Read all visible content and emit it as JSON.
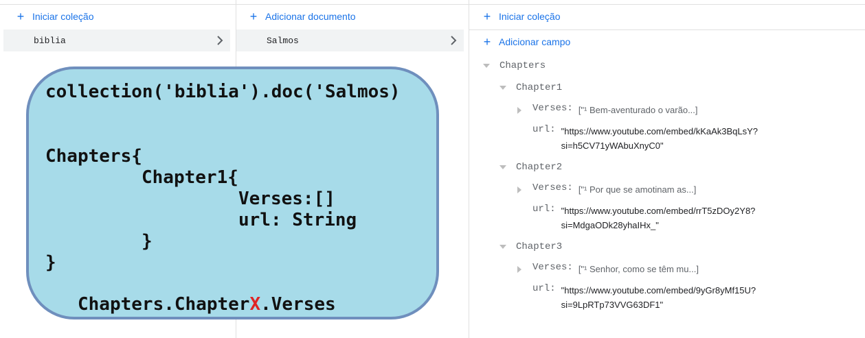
{
  "panel1": {
    "add_label": "Iniciar coleção",
    "items": [
      {
        "label": "biblia"
      }
    ]
  },
  "panel2": {
    "add_label": "Adicionar documento",
    "items": [
      {
        "label": "Salmos"
      }
    ]
  },
  "panel3": {
    "add_collection_label": "Iniciar coleção",
    "add_field_label": "Adicionar campo",
    "root_field": "Chapters",
    "chapters": [
      {
        "name": "Chapter1",
        "verses_key": "Verses:",
        "verses_value": "[\"¹ Bem-aventurado o varão...]",
        "url_key": "url:",
        "url_line1": "\"https://www.youtube.com/embed/kKaAk3BqLsY?",
        "url_line2": "si=h5CV71yWAbuXnyC0\""
      },
      {
        "name": "Chapter2",
        "verses_key": "Verses:",
        "verses_value": "[\"¹ Por que se amotinam as...]",
        "url_key": "url:",
        "url_line1": "\"https://www.youtube.com/embed/rrT5zDOy2Y8?",
        "url_line2": "si=MdgaODk28yhaIHx_\""
      },
      {
        "name": "Chapter3",
        "verses_key": "Verses:",
        "verses_value": "[\"¹ Senhor, como se têm mu...]",
        "url_key": "url:",
        "url_line1": "\"https://www.youtube.com/embed/9yGr8yMf15U?",
        "url_line2": "si=9LpRTp73VVG63DF1\""
      }
    ]
  },
  "overlay": {
    "line1": "collection('biblia').doc('Salmos)",
    "line2": "Chapters{",
    "line3": "Chapter1{",
    "line4": "Verses:[]",
    "line5": "url: String",
    "line6": "}",
    "line7": "}",
    "footer_prefix": "Chapters.Chapter",
    "footer_highlight": "X",
    "footer_suffix": ".Verses"
  },
  "colors": {
    "accent": "#1a73e8",
    "overlay_fill": "#a7dbe9",
    "overlay_border": "#6f8fbd",
    "highlight": "#e02424"
  },
  "icons": [
    "plus-icon",
    "chevron-right-icon",
    "caret-down-icon",
    "caret-right-icon"
  ]
}
